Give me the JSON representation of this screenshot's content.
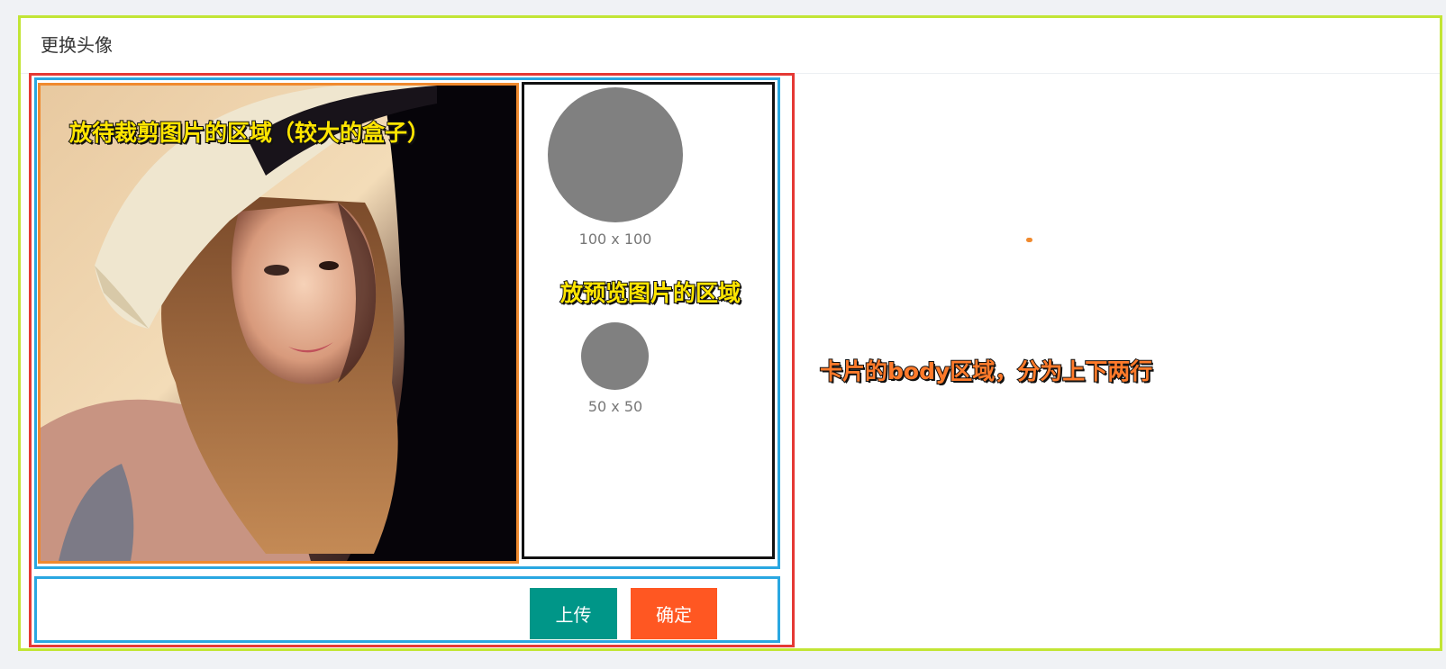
{
  "card": {
    "title": "更换头像",
    "border_color": "#c2e535"
  },
  "crop_area": {
    "annotation": "放待裁剪图片的区域（较大的盒子）",
    "image": "portrait-photo"
  },
  "preview_area": {
    "annotation": "放预览图片的区域",
    "previews": [
      {
        "label": "100 x 100"
      },
      {
        "label": "50 x 50"
      }
    ]
  },
  "body_annotation": "卡片的body区域，分为上下两行",
  "buttons": {
    "upload_label": "上传",
    "upload_color": "#009688",
    "confirm_label": "确定",
    "confirm_color": "#ff5722"
  },
  "annotation_colors": {
    "red": "#e53935",
    "blue": "#2aa7e1",
    "orange": "#f08a2e",
    "yellow_text": "#ffe500",
    "orange_text": "#ff7a2a"
  }
}
